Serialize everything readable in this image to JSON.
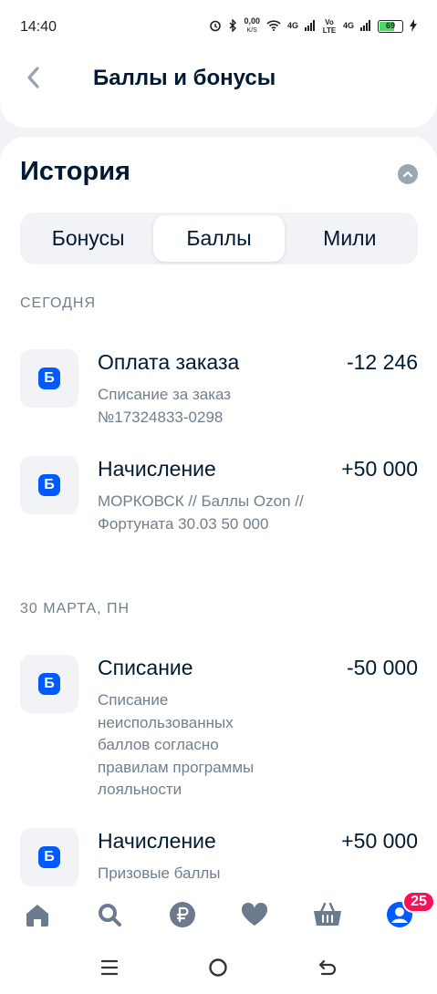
{
  "status_bar": {
    "time": "14:40",
    "speed": "0,00",
    "speed_unit": "K/S",
    "net1": "4G",
    "volte": "Vo LTE",
    "net2": "4G",
    "battery": "69",
    "icons": [
      "alarm-icon",
      "bluetooth-icon",
      "wifi-icon",
      "signal-icon",
      "battery-icon",
      "charging-icon"
    ]
  },
  "header": {
    "title": "Баллы и бонусы",
    "back_icon": "chevron-left-icon"
  },
  "history": {
    "title": "История",
    "collapse_icon": "chevron-up-icon",
    "tabs": [
      {
        "label": "Бонусы",
        "active": false
      },
      {
        "label": "Баллы",
        "active": true
      },
      {
        "label": "Мили",
        "active": false
      }
    ],
    "groups": [
      {
        "label": "СЕГОДНЯ",
        "items": [
          {
            "badge": "Б",
            "title": "Оплата заказа",
            "amount": "-12 246",
            "desc": "Списание за заказ №17324833-0298"
          },
          {
            "badge": "Б",
            "title": "Начисление",
            "amount": "+50 000",
            "desc": "МОРКОВСК // Баллы Ozon // Фортуната 30.03 50 000"
          }
        ]
      },
      {
        "label": "30 МАРТА, ПН",
        "items": [
          {
            "badge": "Б",
            "title": "Списание",
            "amount": "-50 000",
            "desc": "Списание неиспользованных баллов согласно правилам программы лояльности"
          },
          {
            "badge": "Б",
            "title": "Начисление",
            "amount": "+50 000",
            "desc": "Призовые баллы"
          }
        ]
      }
    ]
  },
  "bottom_nav": {
    "items": [
      "home-icon",
      "search-icon",
      "ruble-icon",
      "heart-icon",
      "basket-icon",
      "profile-icon"
    ],
    "profile_badge": "25"
  },
  "colors": {
    "accent": "#005bff",
    "text": "#001a34",
    "secondary_text": "#707f8d",
    "nav_icon": "#6b7a8c",
    "badge": "#f91155",
    "background": "#f2f3f7"
  }
}
